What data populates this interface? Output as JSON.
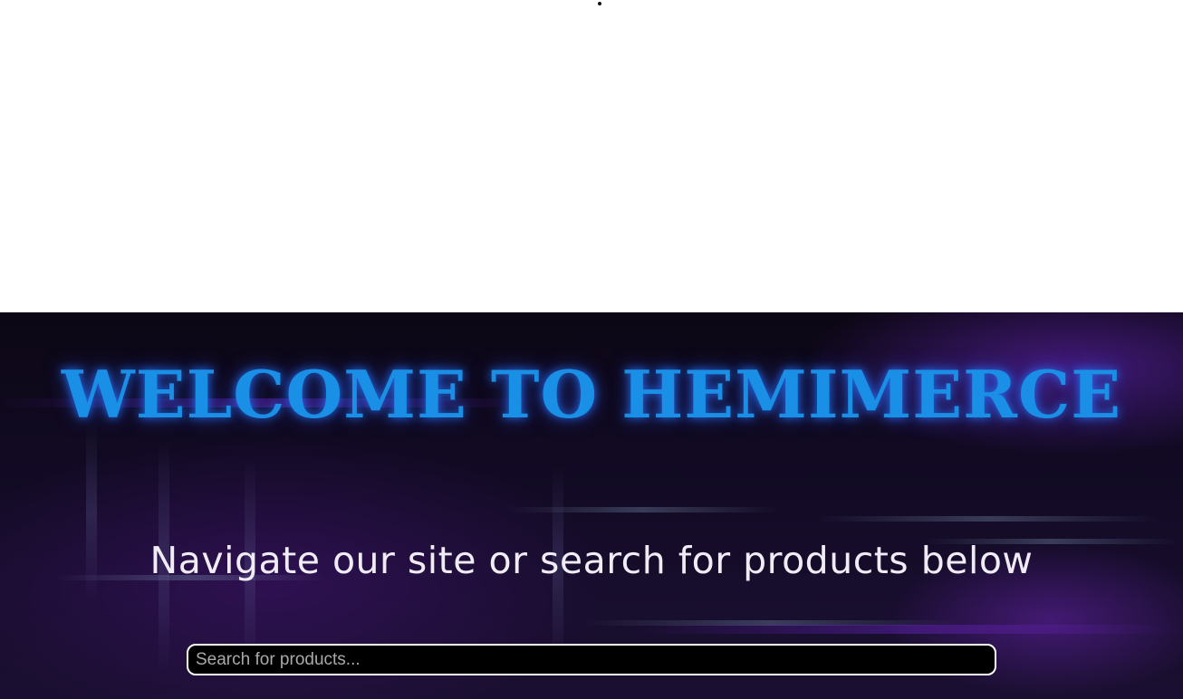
{
  "hero": {
    "title": "WELCOME TO HEMIMERCE",
    "subtitle": "Navigate our site or search for products below"
  },
  "search": {
    "placeholder": "Search for products...",
    "value": ""
  },
  "colors": {
    "title": "#1a8fe6",
    "subtitle": "#f0ecf6",
    "search_background": "#000000",
    "search_border": "#ffffff"
  }
}
